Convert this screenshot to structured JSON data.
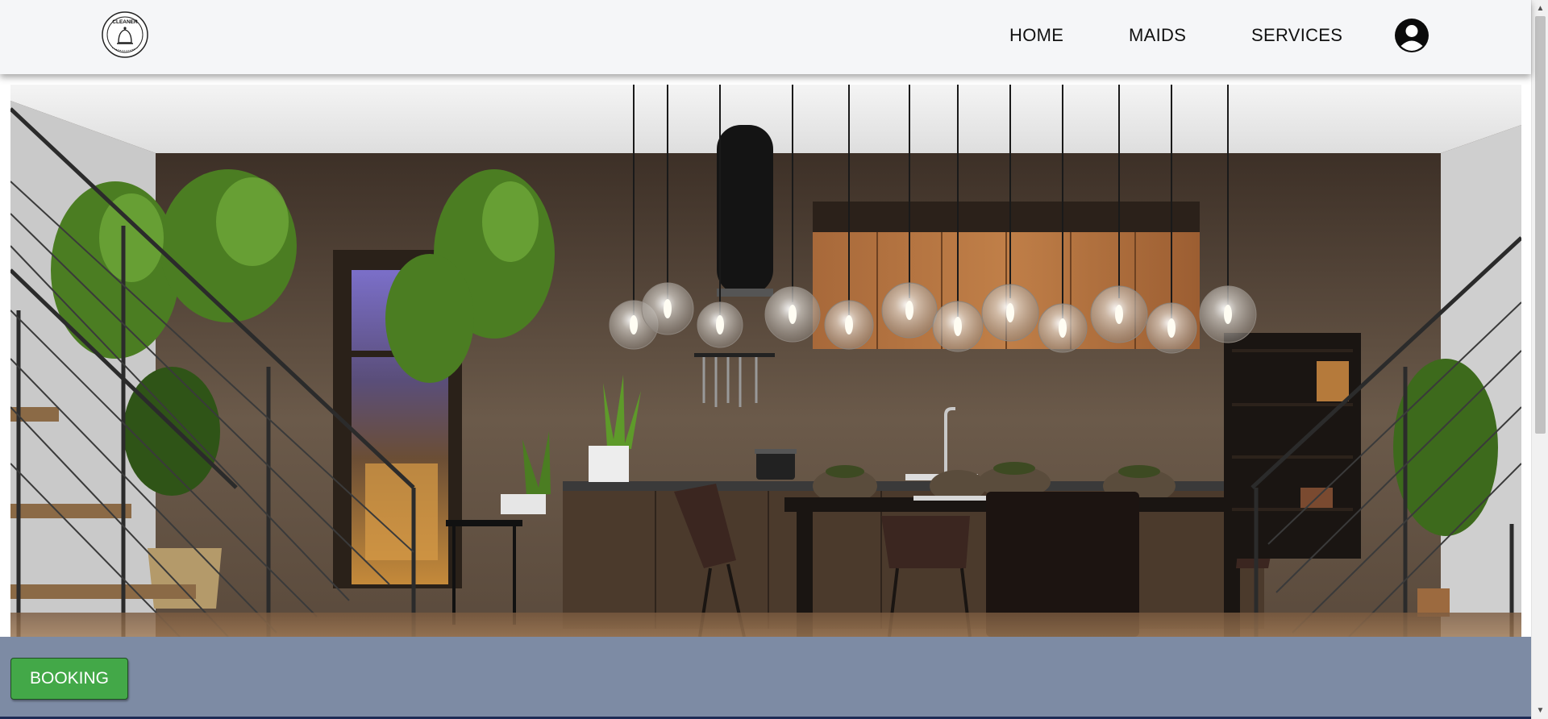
{
  "header": {
    "logo": {
      "icon": "cleaner-bell-logo",
      "text": "CLEANER"
    },
    "nav": [
      {
        "label": "HOME"
      },
      {
        "label": "MAIDS"
      },
      {
        "label": "SERVICES"
      }
    ],
    "account": {
      "icon": "user-account-icon"
    }
  },
  "hero": {
    "image": "modern-kitchen-with-pendant-lights"
  },
  "footer": {
    "booking_label": "BOOKING",
    "colors": {
      "bar": "#7d8ba4",
      "button": "#43a848"
    }
  },
  "scrollbar": {
    "up_icon": "scroll-up-arrow",
    "down_icon": "scroll-down-arrow"
  }
}
